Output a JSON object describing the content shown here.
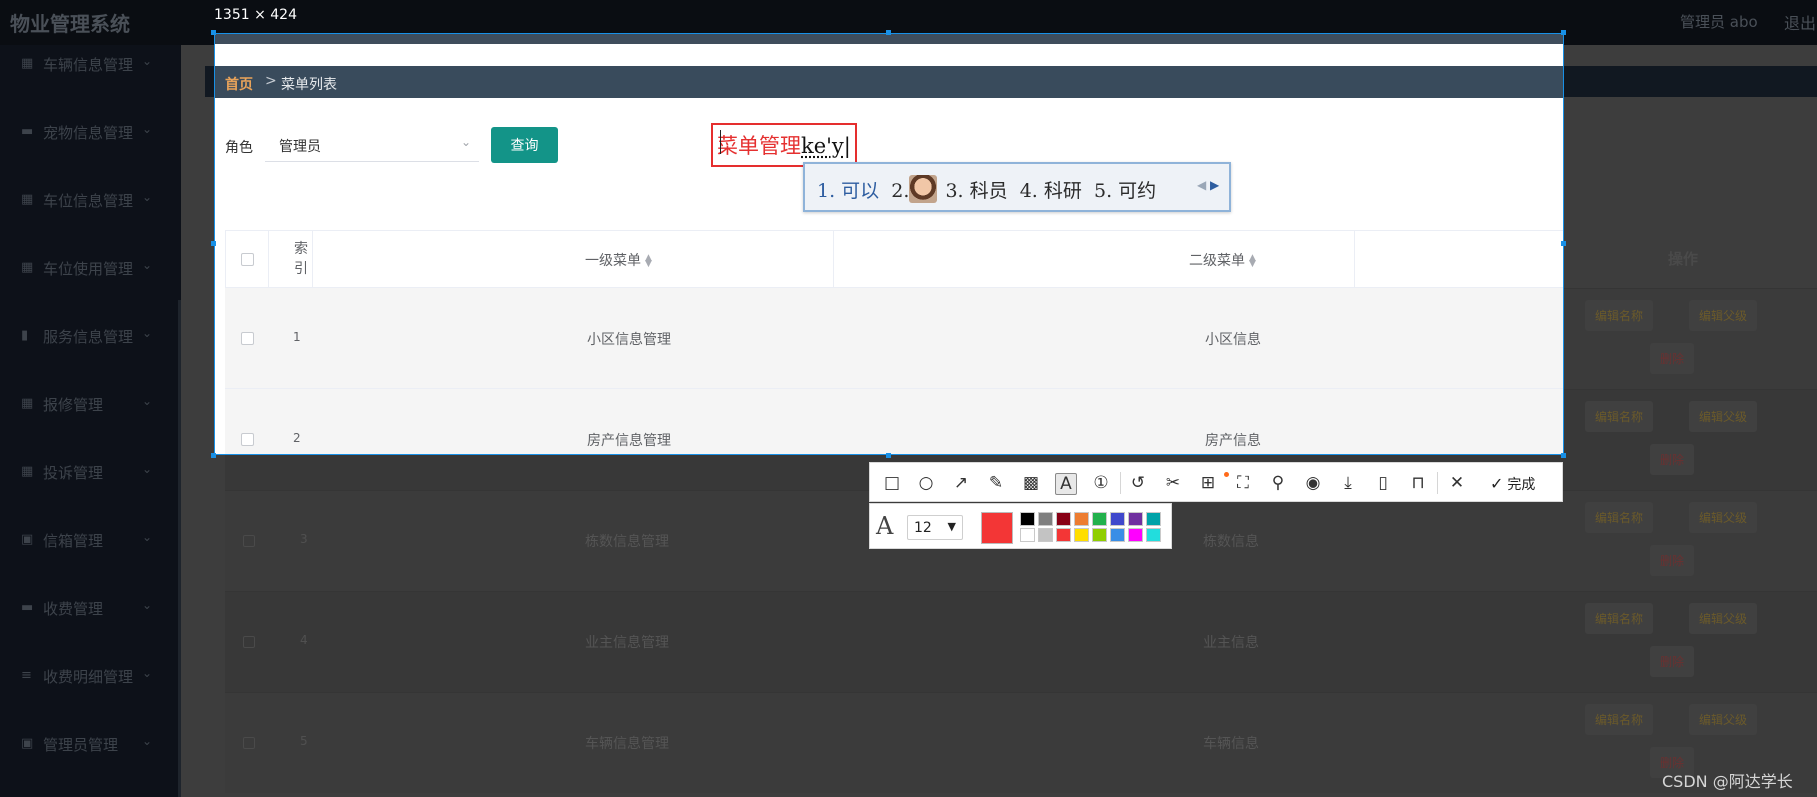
{
  "app": {
    "title": "物业管理系统",
    "user": "管理员 abo",
    "logout": "退出"
  },
  "sidebar": {
    "items": [
      {
        "label": "车辆信息管理",
        "icon": "grid-icon"
      },
      {
        "label": "宠物信息管理",
        "icon": "pet-icon"
      },
      {
        "label": "车位信息管理",
        "icon": "grid-icon"
      },
      {
        "label": "车位使用管理",
        "icon": "grid-icon"
      },
      {
        "label": "服务信息管理",
        "icon": "chart-icon"
      },
      {
        "label": "报修管理",
        "icon": "grid-icon"
      },
      {
        "label": "投诉管理",
        "icon": "grid-icon"
      },
      {
        "label": "信箱管理",
        "icon": "clipboard-icon"
      },
      {
        "label": "收费管理",
        "icon": "chat-icon"
      },
      {
        "label": "收费明细管理",
        "icon": "list-icon"
      },
      {
        "label": "管理员管理",
        "icon": "clipboard-icon"
      }
    ]
  },
  "capture": {
    "dimensions": "1351 × 424",
    "breadcrumb": {
      "home": "首页",
      "separator": ">",
      "current": "菜单列表"
    },
    "filter": {
      "role_label": "角色",
      "role_value": "管理员",
      "query_button": "查询"
    },
    "annotation": {
      "text": "菜单管理",
      "composing": "ke'y"
    },
    "ime": {
      "c1": "1. 可以",
      "c2": "2.",
      "c3": "3. 科员",
      "c4": "4. 科研",
      "c5": "5. 可约"
    }
  },
  "table": {
    "headers": {
      "index_line1": "索",
      "index_line2": "引",
      "col1": "一级菜单",
      "col2": "二级菜单",
      "ops": "操作"
    },
    "rows": [
      {
        "index": "1",
        "col1": "小区信息管理",
        "col2": "小区信息"
      },
      {
        "index": "2",
        "col1": "房产信息管理",
        "col2": "房产信息"
      },
      {
        "index": "3",
        "col1": "栋数信息管理",
        "col2": "栋数信息"
      },
      {
        "index": "4",
        "col1": "业主信息管理",
        "col2": "业主信息"
      },
      {
        "index": "5",
        "col1": "车辆信息管理",
        "col2": "车辆信息"
      }
    ],
    "actions": {
      "edit_name": "编辑名称",
      "edit_parent": "编辑父级",
      "delete": "删除"
    }
  },
  "toolbar": {
    "done": "完成",
    "tools": [
      "rectangle-icon",
      "ellipse-icon",
      "arrow-icon",
      "pencil-icon",
      "mosaic-icon",
      "text-icon",
      "number-icon",
      "undo-icon",
      "cut-icon",
      "translate-icon",
      "ocr-icon",
      "pin-icon",
      "record-icon",
      "download-icon",
      "long-screenshot-icon",
      "bookmark-icon",
      "close-icon",
      "check-icon"
    ]
  },
  "textbar": {
    "font_size": "12",
    "current_color": "#f33636",
    "palette_top": [
      "#000000",
      "#7f7f7f",
      "#880015",
      "#ed7d31",
      "#22b14c",
      "#3f48cc",
      "#7030a0",
      "#00a2a8"
    ],
    "palette_bottom": [
      "#ffffff",
      "#c3c3c3",
      "#f33636",
      "#ffde00",
      "#8fce00",
      "#3a8ee6",
      "#ff00ff",
      "#22dddd"
    ]
  },
  "watermark": "CSDN @阿达学长"
}
